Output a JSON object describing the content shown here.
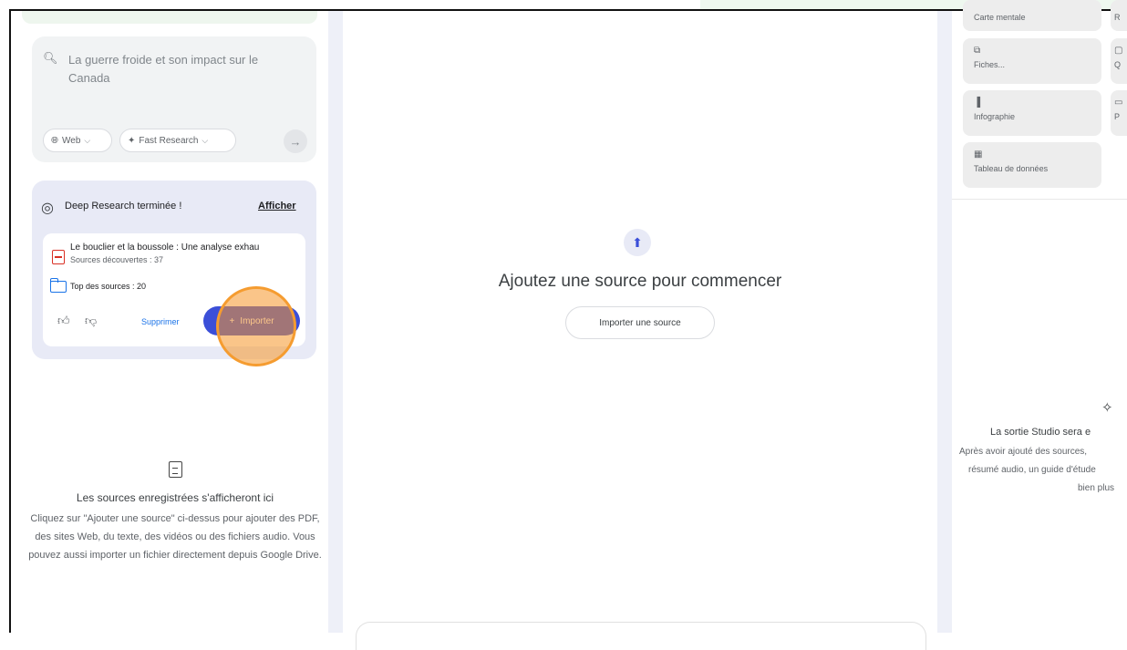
{
  "sources_panel": {
    "search": {
      "placeholder": "La guerre froide et son impact sur le Canada",
      "web_pill": "Web",
      "research_pill": "Fast Research"
    },
    "deep_research": {
      "title": "Deep Research terminée !",
      "show_link": "Afficher",
      "report_title": "Le bouclier et la boussole : Une analyse exhau",
      "sources_found": "Sources découvertes : 37",
      "top_sources": "Top des sources : 20",
      "delete_label": "Supprimer",
      "import_label": "Importer"
    },
    "empty_state": {
      "title": "Les sources enregistrées s'afficheront ici",
      "description": "Cliquez sur \"Ajouter une source\" ci-dessus pour ajouter des PDF, des sites Web, du texte, des vidéos ou des fichiers audio. Vous pouvez aussi importer un fichier directement depuis Google Drive."
    }
  },
  "center_panel": {
    "heading": "Ajoutez une source pour commencer",
    "import_button": "Importer une source"
  },
  "studio_panel": {
    "tiles": [
      {
        "label": "Carte mentale",
        "icon": "mind-map-icon"
      },
      {
        "label": "Fiches...",
        "icon": "flashcards-icon"
      },
      {
        "label": "Infographie",
        "icon": "infographic-icon"
      },
      {
        "label": "Tableau de données",
        "icon": "data-table-icon"
      }
    ],
    "tiles_right_partial": [
      {
        "label": "R",
        "icon": "report-icon"
      },
      {
        "label": "Q",
        "icon": "quiz-icon"
      },
      {
        "label": "P",
        "icon": "presentation-icon"
      }
    ],
    "empty_lines": [
      "La sortie Studio sera e",
      "Après avoir ajouté des sources,",
      "résumé audio, un guide d'étude",
      "bien plus"
    ]
  }
}
